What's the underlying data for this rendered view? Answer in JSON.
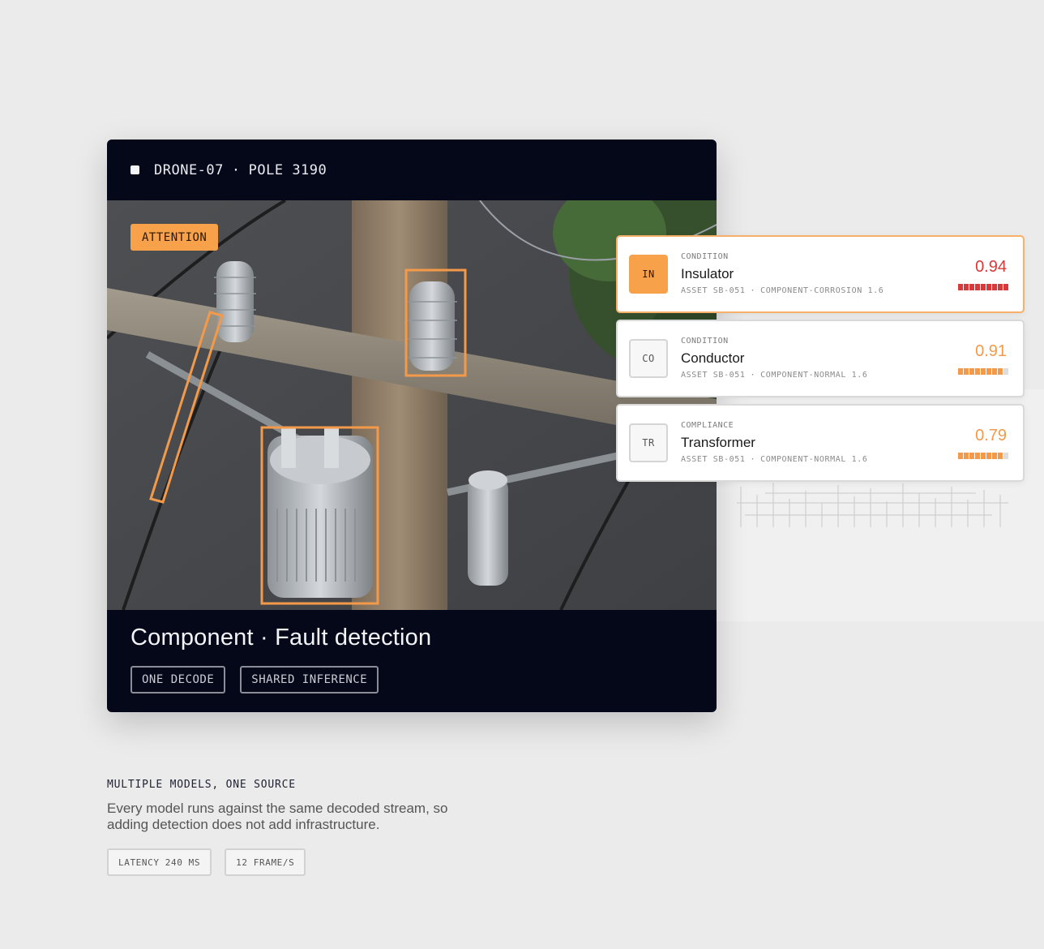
{
  "camera": {
    "source": "DRONE-07",
    "separator": "·",
    "location": "POLE 3190"
  },
  "overlay": {
    "status_label": "ATTENTION"
  },
  "card": {
    "title": "Component · Fault detection",
    "chips": [
      "ONE DECODE",
      "SHARED INFERENCE"
    ]
  },
  "results": [
    {
      "badge": "IN",
      "kind": "CONDITION",
      "name": "Insulator",
      "asset": "ASSET SB-051",
      "model": "COMPONENT-CORROSION 1.6",
      "score": "0.94",
      "score_value": 0.94,
      "filled_segments": 9,
      "total_segments": 9,
      "color": "#d63a3a",
      "active": true
    },
    {
      "badge": "CO",
      "kind": "CONDITION",
      "name": "Conductor",
      "asset": "ASSET SB-051",
      "model": "COMPONENT-NORMAL 1.6",
      "score": "0.91",
      "score_value": 0.91,
      "filled_segments": 8,
      "total_segments": 9,
      "color": "#f39a4a",
      "active": false
    },
    {
      "badge": "TR",
      "kind": "COMPLIANCE",
      "name": "Transformer",
      "asset": "ASSET SB-051",
      "model": "COMPONENT-NORMAL 1.6",
      "score": "0.79",
      "score_value": 0.79,
      "filled_segments": 8,
      "total_segments": 9,
      "color": "#f39a4a",
      "active": false
    }
  ],
  "footer": {
    "eyebrow": "MULTIPLE MODELS, ONE SOURCE",
    "description": "Every model runs against the same decoded stream, so adding detection does not add infrastructure.",
    "chips": [
      "LATENCY 240 MS",
      "12 FRAME/S"
    ]
  },
  "colors": {
    "accent": "#f7a24a",
    "card_bg": "#040818",
    "alert": "#d63a3a"
  }
}
